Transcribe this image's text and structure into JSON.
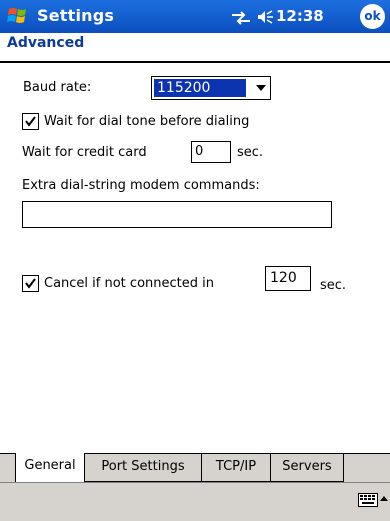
{
  "titlebar": {
    "title": "Settings",
    "time": "12:38",
    "ok_label": "ok"
  },
  "section": {
    "heading": "Advanced"
  },
  "form": {
    "baud_label": "Baud rate:",
    "baud_value": "115200",
    "dialtone_label": "Wait for dial tone before dialing",
    "dialtone_checked": true,
    "credit_label": "Wait for credit card",
    "credit_value": "0",
    "credit_unit": "sec.",
    "extra_label": "Extra dial-string modem commands:",
    "extra_value": "",
    "cancel_label": "Cancel if not connected in",
    "cancel_checked": true,
    "cancel_value": "120",
    "cancel_unit": "sec."
  },
  "tabs": [
    {
      "label": "General",
      "active": true
    },
    {
      "label": "Port Settings",
      "active": false
    },
    {
      "label": "TCP/IP",
      "active": false
    },
    {
      "label": "Servers",
      "active": false
    }
  ],
  "icons": {
    "start": "windows-flag-icon",
    "connectivity": "connectivity-icon",
    "volume": "speaker-icon",
    "input_panel": "keyboard-icon"
  },
  "colors": {
    "titlebar": "#0c4fbe",
    "heading": "#0c3b9c",
    "selection": "#0c34b0",
    "chrome": "#d6d3ce"
  }
}
